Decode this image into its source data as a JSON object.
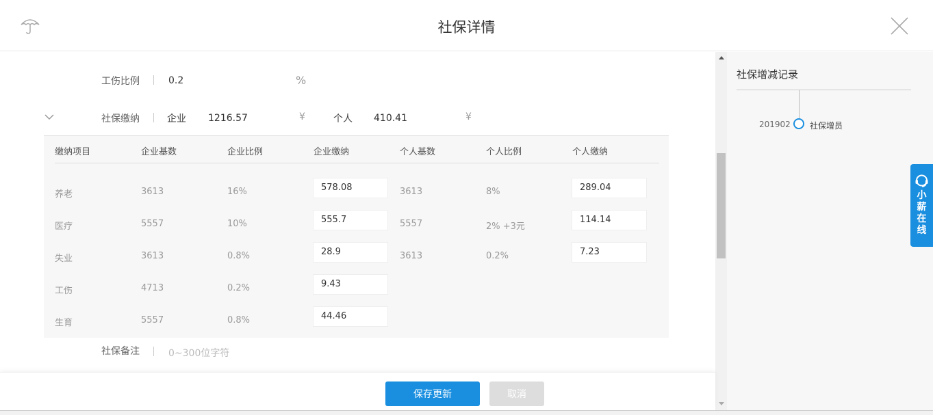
{
  "header": {
    "title": "社保详情"
  },
  "form": {
    "injury_ratio": {
      "label": "工伤比例",
      "value": "0.2",
      "unit": "%"
    },
    "payment": {
      "label": "社保缴纳",
      "company_label": "企业",
      "company_value": "1216.57",
      "company_unit": "¥",
      "personal_label": "个人",
      "personal_value": "410.41",
      "personal_unit": "¥"
    },
    "remark": {
      "label": "社保备注",
      "placeholder": "0~300位字符"
    }
  },
  "table": {
    "headers": [
      "缴纳项目",
      "企业基数",
      "企业比例",
      "企业缴纳",
      "个人基数",
      "个人比例",
      "个人缴纳"
    ],
    "rows": [
      {
        "item": "养老",
        "company_base": "3613",
        "company_ratio": "16%",
        "company_pay": "578.08",
        "personal_base": "3613",
        "personal_ratio": "8%",
        "personal_pay": "289.04"
      },
      {
        "item": "医疗",
        "company_base": "5557",
        "company_ratio": "10%",
        "company_pay": "555.7",
        "personal_base": "5557",
        "personal_ratio": "2% +3元",
        "personal_pay": "114.14"
      },
      {
        "item": "失业",
        "company_base": "3613",
        "company_ratio": "0.8%",
        "company_pay": "28.9",
        "personal_base": "3613",
        "personal_ratio": "0.2%",
        "personal_pay": "7.23"
      },
      {
        "item": "工伤",
        "company_base": "4713",
        "company_ratio": "0.2%",
        "company_pay": "9.43"
      },
      {
        "item": "生育",
        "company_base": "5557",
        "company_ratio": "0.8%",
        "company_pay": "44.46"
      }
    ]
  },
  "sidebar": {
    "title": "社保增减记录",
    "records": [
      {
        "date": "201902",
        "label": "社保增员"
      }
    ]
  },
  "chat_widget": {
    "label": "小薪在线"
  },
  "footer": {
    "save_label": "保存更新",
    "cancel_label": "取消"
  },
  "colors": {
    "primary": "#1a8fe0",
    "panel_bg": "#f7f7f7",
    "disabled": "#dddddd"
  }
}
